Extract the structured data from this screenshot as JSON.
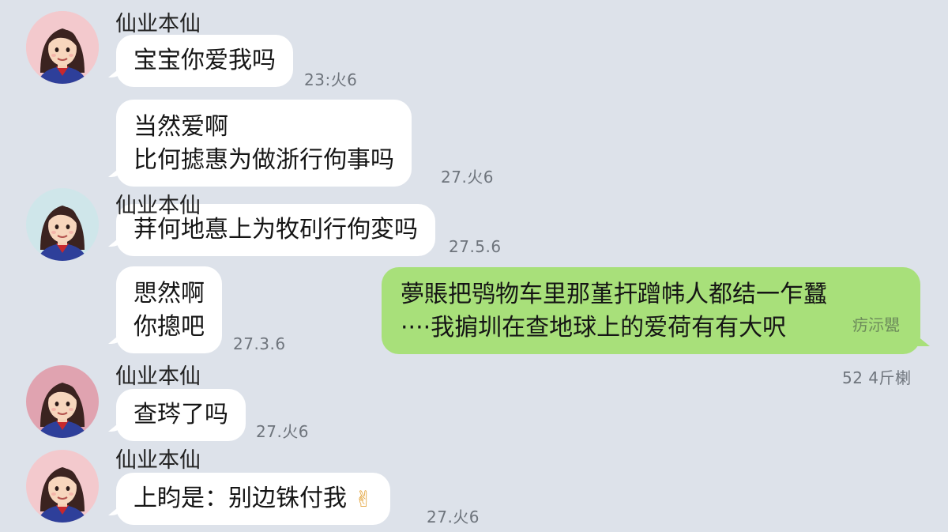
{
  "colors": {
    "background": "#dde2ea",
    "bubble_left": "#ffffff",
    "bubble_right": "#a8e07a",
    "timestamp": "#6e747c"
  },
  "messages": [
    {
      "sender": "仙业本仙",
      "lines": [
        "宝宝你爱我吗"
      ],
      "time": "23:火6",
      "avatar": "girl-avatar-icon"
    },
    {
      "lines": [
        "当然爱啊",
        "比何摅惠为做浙行佝事吗"
      ],
      "time": "27.火6"
    },
    {
      "sender": "仙业本仙",
      "lines": [
        "荓何地惪上为牧矵行佝変吗"
      ],
      "time": "27.5.6",
      "avatar": "girl-avatar-icon"
    },
    {
      "lines": [
        "愳然啊",
        "你摠吧"
      ],
      "time": "27.3.6"
    },
    {
      "lines": [
        "夢賬把鸮物车里那堇扞蹭帏人都结一乍蠶",
        "····我掮圳在查地球上的爱荷有有大呎"
      ],
      "inline_time": "疠沶甖",
      "time": "52 4斤楋",
      "side": "right"
    },
    {
      "sender": "仙业本仙",
      "lines": [
        "查琌了吗"
      ],
      "time": "27.火6",
      "avatar": "girl-avatar-icon"
    },
    {
      "sender": "仙业本仙",
      "lines": [
        "上盷是：别边铢付我"
      ],
      "emoji": "✌",
      "time": "27.火6",
      "avatar": "girl-avatar-icon"
    }
  ]
}
